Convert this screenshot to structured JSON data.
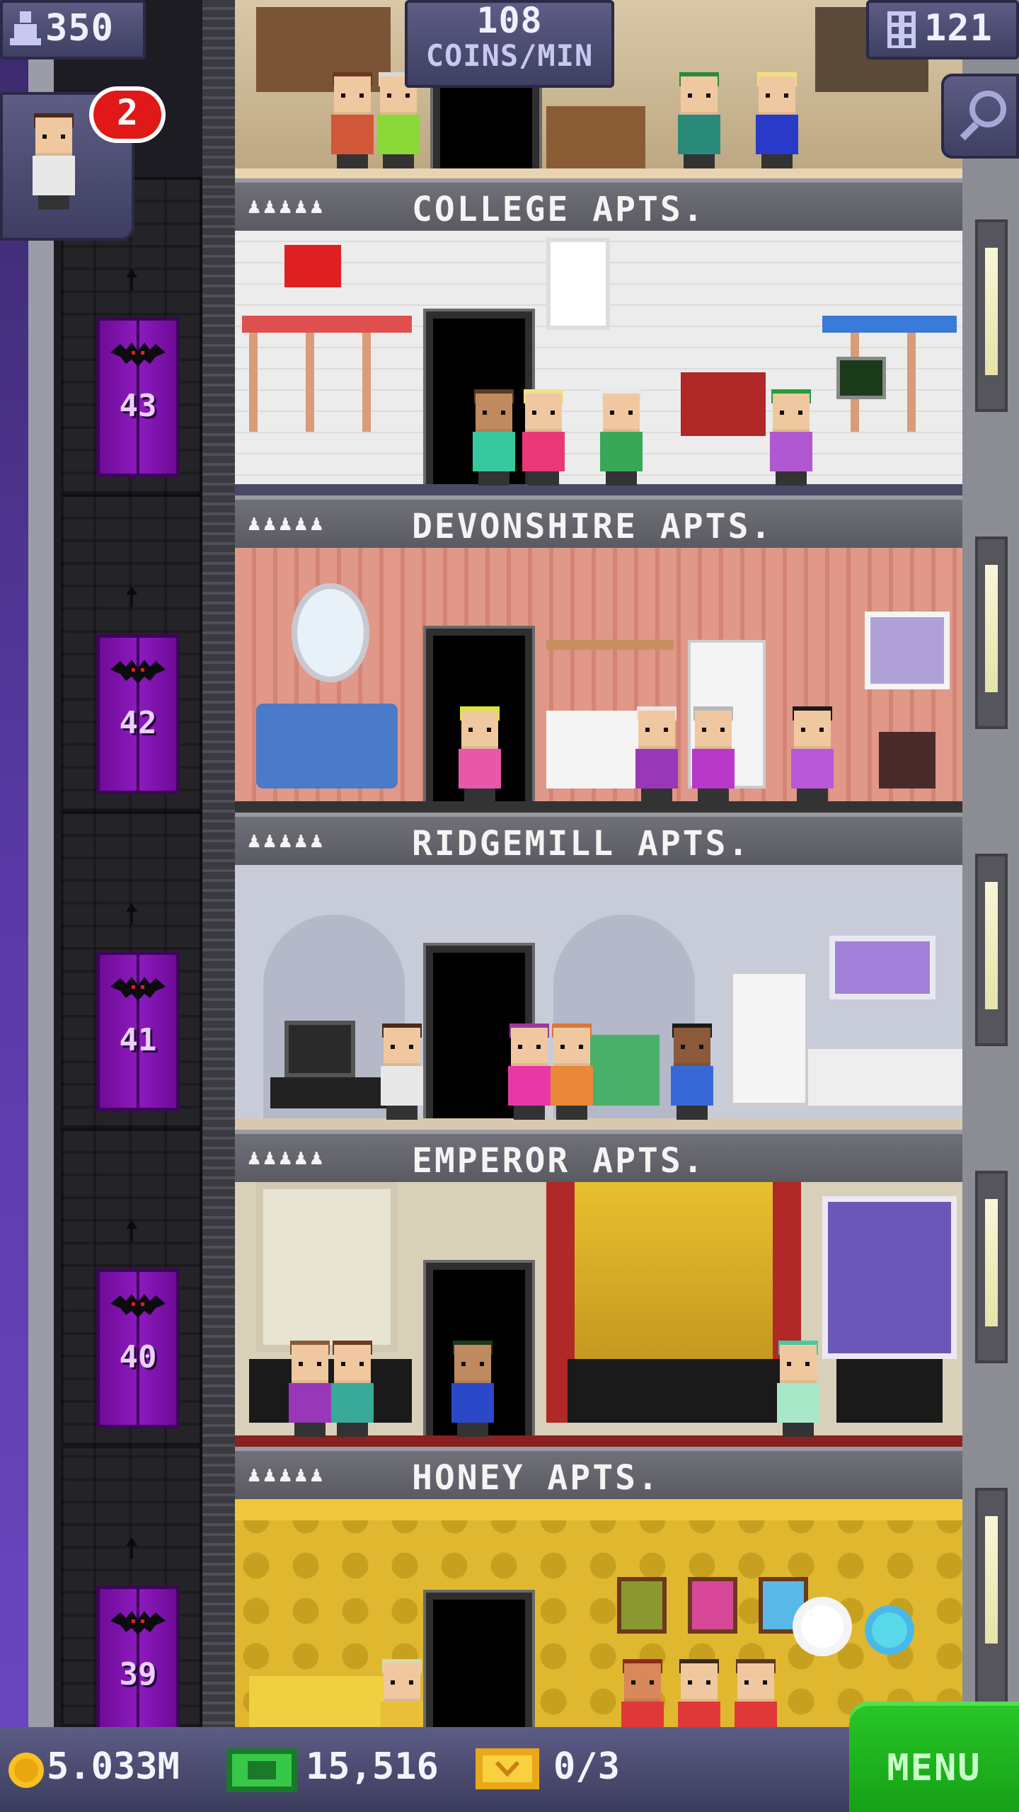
{
  "hud": {
    "population": "350",
    "coins_rate_line1": "108",
    "coins_rate_line2": "COINS/MIN",
    "floors": "121",
    "notification_count": "2"
  },
  "elevator": {
    "floor_numbers": [
      "43",
      "42",
      "41",
      "40",
      "39"
    ]
  },
  "floors": [
    {
      "name": "COLLEGE APTS.",
      "people": "♟♟♟♟♟"
    },
    {
      "name": "DEVONSHIRE APTS.",
      "people": "♟♟♟♟♟"
    },
    {
      "name": "RIDGEMILL APTS.",
      "people": "♟♟♟♟♟"
    },
    {
      "name": "EMPEROR APTS.",
      "people": "♟♟♟♟♟"
    },
    {
      "name": "HONEY APTS.",
      "people": "♟♟♟♟♟"
    }
  ],
  "bottom_bar": {
    "coins": "5.033M",
    "bux": "15,516",
    "tickets": "0/3",
    "menu_label": "MENU"
  },
  "icons": [
    "person-icon",
    "building-icon",
    "magnifier-icon",
    "coin-icon",
    "bux-icon",
    "ticket-icon",
    "bat-icon"
  ],
  "colors": {
    "elevator": "#8e1ac0",
    "hud": "#4c4c74",
    "menu": "#1eb41e",
    "notification": "#e01818"
  }
}
